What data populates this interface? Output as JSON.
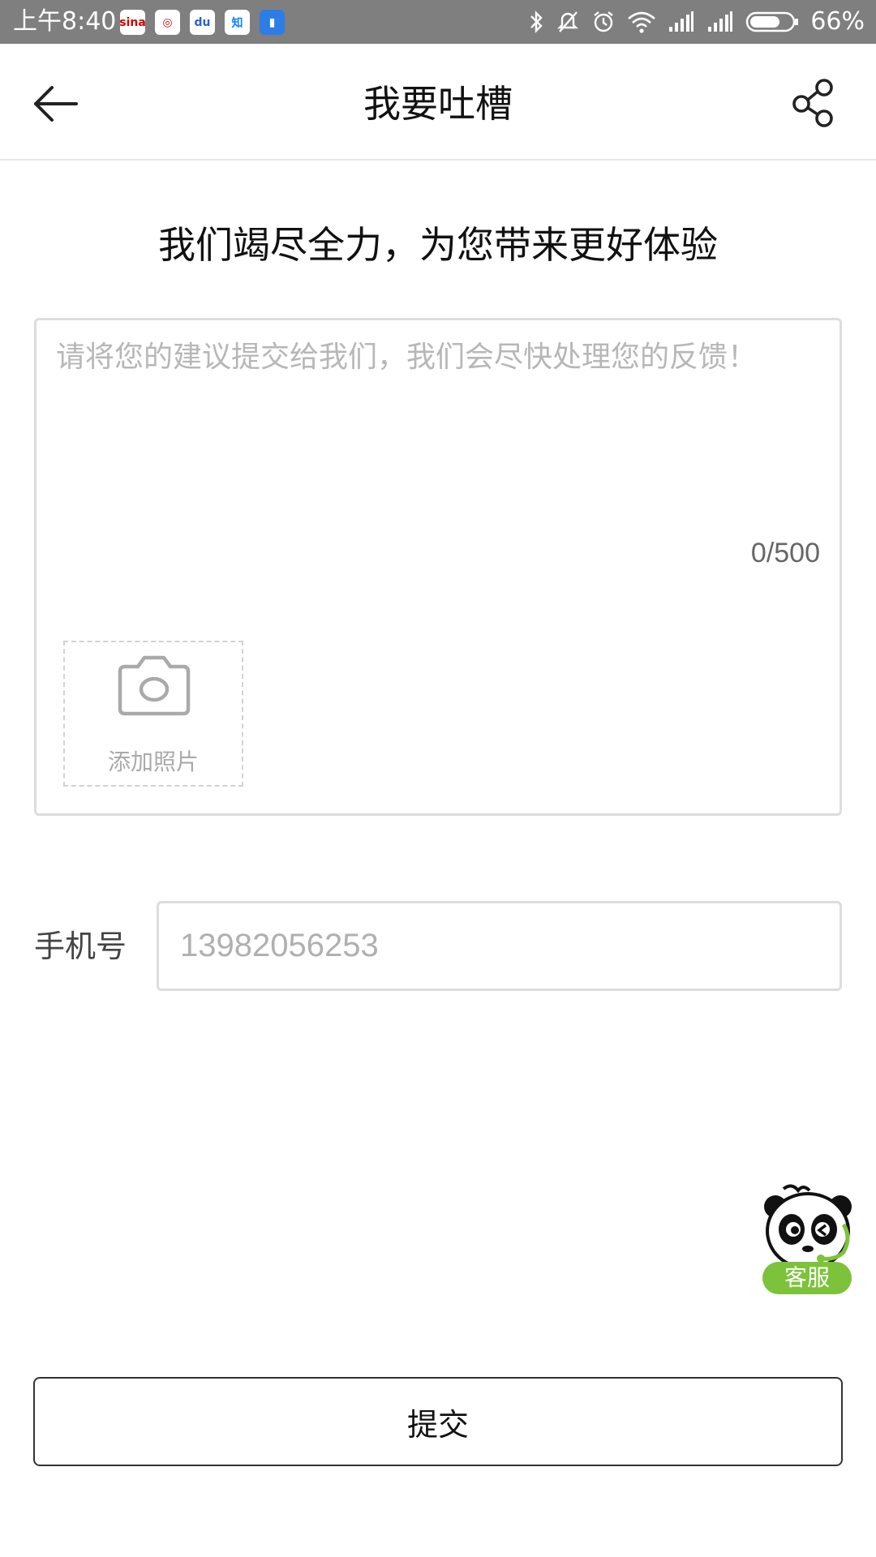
{
  "status_bar": {
    "time": "上午8:40",
    "apps": [
      {
        "icon": "sina-weibo-icon",
        "text": "sina",
        "bg": "#ffffff",
        "fg": "#d40000"
      },
      {
        "icon": "netease-news-icon",
        "text": "◎",
        "bg": "#ffffff",
        "fg": "#d80c18"
      },
      {
        "icon": "baidu-icon",
        "text": "du",
        "bg": "#ffffff",
        "fg": "#2b5fd9"
      },
      {
        "icon": "zhihu-icon",
        "text": "知",
        "bg": "#ffffff",
        "fg": "#0a84ff"
      },
      {
        "icon": "document-app-icon",
        "text": "▮",
        "bg": "#2d7de6",
        "fg": "#ffffff"
      }
    ],
    "battery": "66%"
  },
  "header": {
    "title": "我要吐槽"
  },
  "subtitle": "我们竭尽全力，为您带来更好体验",
  "feedback": {
    "placeholder": "请将您的建议提交给我们，我们会尽快处理您的反馈！",
    "value": "",
    "counter": "0/500",
    "add_photo_label": "添加照片"
  },
  "phone": {
    "label": "手机号",
    "placeholder": "13982056253"
  },
  "service": {
    "label": "客服"
  },
  "submit": {
    "label": "提交"
  },
  "colors": {
    "status_bar_bg": "#7f7f7f",
    "border": "#dddddd",
    "placeholder": "#b7b7b7",
    "service_green": "#7cc23a"
  }
}
